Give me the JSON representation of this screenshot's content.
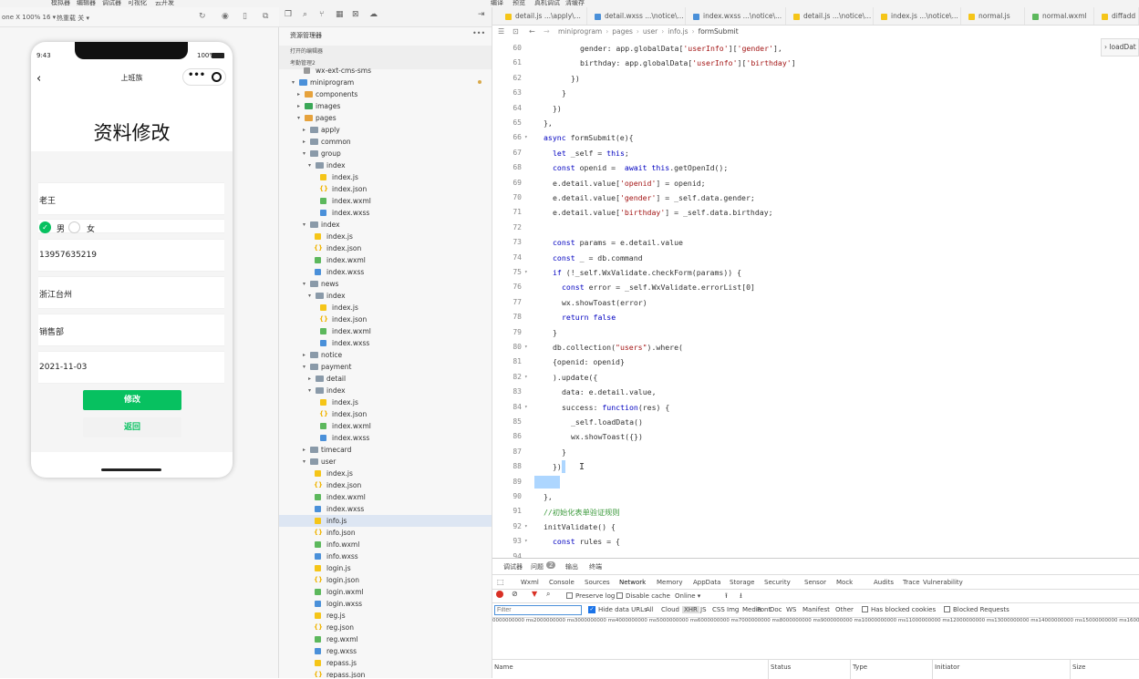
{
  "menu": [
    "模拟器",
    "编辑器",
    "调试器",
    "可视化",
    "云开发",
    "编译",
    "预览",
    "真机调试",
    "清缓存"
  ],
  "simulator": {
    "device": "one X 100% 16 ▾",
    "reload": "热重载 关 ▾",
    "status_time": "9:43",
    "status_battery": "100%",
    "nav_title": "上班族",
    "capsule_dots": "•••",
    "page_title": "资料修改",
    "fields": {
      "name": "老王",
      "gender_male": "男",
      "gender_female": "女",
      "phone": "13957635219",
      "city": "浙江台州",
      "department": "销售部",
      "birthday": "2021-11-03"
    },
    "buttons": {
      "submit": "修改",
      "back": "返回"
    },
    "colors": {
      "primary": "#07c160",
      "back_bg": "#f2f2f2"
    }
  },
  "explorer": {
    "title": "资源管理器",
    "more": "•••",
    "section_open": "打开的编辑器",
    "section_project": "考勤管理2",
    "tree": [
      {
        "d": 2,
        "t": "f",
        "n": "wx-ext-cms-sms",
        "c": "#999"
      },
      {
        "d": 1,
        "t": "o",
        "n": "miniprogram",
        "c": "#4a90d9",
        "dot": true
      },
      {
        "d": 2,
        "t": "c",
        "n": "components",
        "c": "#e6a23c"
      },
      {
        "d": 2,
        "t": "c",
        "n": "images",
        "c": "#3aa757"
      },
      {
        "d": 2,
        "t": "o",
        "n": "pages",
        "c": "#e6a23c"
      },
      {
        "d": 3,
        "t": "c",
        "n": "apply",
        "c": "#8a9aa9"
      },
      {
        "d": 3,
        "t": "c",
        "n": "common",
        "c": "#8a9aa9"
      },
      {
        "d": 3,
        "t": "o",
        "n": "group",
        "c": "#8a9aa9"
      },
      {
        "d": 4,
        "t": "o",
        "n": "index",
        "c": "#8a9aa9"
      },
      {
        "d": 5,
        "t": "f",
        "n": "index.js",
        "c": "#f5c518"
      },
      {
        "d": 5,
        "t": "f",
        "n": "index.json",
        "c": "#f0b400",
        "j": true
      },
      {
        "d": 5,
        "t": "f",
        "n": "index.wxml",
        "c": "#5cb85c"
      },
      {
        "d": 5,
        "t": "f",
        "n": "index.wxss",
        "c": "#4a90d9"
      },
      {
        "d": 3,
        "t": "o",
        "n": "index",
        "c": "#8a9aa9"
      },
      {
        "d": 4,
        "t": "f",
        "n": "index.js",
        "c": "#f5c518"
      },
      {
        "d": 4,
        "t": "f",
        "n": "index.json",
        "c": "#f0b400",
        "j": true
      },
      {
        "d": 4,
        "t": "f",
        "n": "index.wxml",
        "c": "#5cb85c"
      },
      {
        "d": 4,
        "t": "f",
        "n": "index.wxss",
        "c": "#4a90d9"
      },
      {
        "d": 3,
        "t": "o",
        "n": "news",
        "c": "#8a9aa9"
      },
      {
        "d": 4,
        "t": "o",
        "n": "index",
        "c": "#8a9aa9"
      },
      {
        "d": 5,
        "t": "f",
        "n": "index.js",
        "c": "#f5c518"
      },
      {
        "d": 5,
        "t": "f",
        "n": "index.json",
        "c": "#f0b400",
        "j": true
      },
      {
        "d": 5,
        "t": "f",
        "n": "index.wxml",
        "c": "#5cb85c"
      },
      {
        "d": 5,
        "t": "f",
        "n": "index.wxss",
        "c": "#4a90d9"
      },
      {
        "d": 3,
        "t": "c",
        "n": "notice",
        "c": "#8a9aa9"
      },
      {
        "d": 3,
        "t": "o",
        "n": "payment",
        "c": "#8a9aa9"
      },
      {
        "d": 4,
        "t": "c",
        "n": "detail",
        "c": "#8a9aa9"
      },
      {
        "d": 4,
        "t": "o",
        "n": "index",
        "c": "#8a9aa9"
      },
      {
        "d": 5,
        "t": "f",
        "n": "index.js",
        "c": "#f5c518"
      },
      {
        "d": 5,
        "t": "f",
        "n": "index.json",
        "c": "#f0b400",
        "j": true
      },
      {
        "d": 5,
        "t": "f",
        "n": "index.wxml",
        "c": "#5cb85c"
      },
      {
        "d": 5,
        "t": "f",
        "n": "index.wxss",
        "c": "#4a90d9"
      },
      {
        "d": 3,
        "t": "c",
        "n": "timecard",
        "c": "#8a9aa9"
      },
      {
        "d": 3,
        "t": "o",
        "n": "user",
        "c": "#8a9aa9"
      },
      {
        "d": 4,
        "t": "f",
        "n": "index.js",
        "c": "#f5c518"
      },
      {
        "d": 4,
        "t": "f",
        "n": "index.json",
        "c": "#f0b400",
        "j": true
      },
      {
        "d": 4,
        "t": "f",
        "n": "index.wxml",
        "c": "#5cb85c"
      },
      {
        "d": 4,
        "t": "f",
        "n": "index.wxss",
        "c": "#4a90d9"
      },
      {
        "d": 4,
        "t": "f",
        "n": "info.js",
        "c": "#f5c518",
        "sel": true
      },
      {
        "d": 4,
        "t": "f",
        "n": "info.json",
        "c": "#f0b400",
        "j": true
      },
      {
        "d": 4,
        "t": "f",
        "n": "info.wxml",
        "c": "#5cb85c"
      },
      {
        "d": 4,
        "t": "f",
        "n": "info.wxss",
        "c": "#4a90d9"
      },
      {
        "d": 4,
        "t": "f",
        "n": "login.js",
        "c": "#f5c518"
      },
      {
        "d": 4,
        "t": "f",
        "n": "login.json",
        "c": "#f0b400",
        "j": true
      },
      {
        "d": 4,
        "t": "f",
        "n": "login.wxml",
        "c": "#5cb85c"
      },
      {
        "d": 4,
        "t": "f",
        "n": "login.wxss",
        "c": "#4a90d9"
      },
      {
        "d": 4,
        "t": "f",
        "n": "reg.js",
        "c": "#f5c518"
      },
      {
        "d": 4,
        "t": "f",
        "n": "reg.json",
        "c": "#f0b400",
        "j": true
      },
      {
        "d": 4,
        "t": "f",
        "n": "reg.wxml",
        "c": "#5cb85c"
      },
      {
        "d": 4,
        "t": "f",
        "n": "reg.wxss",
        "c": "#4a90d9"
      },
      {
        "d": 4,
        "t": "f",
        "n": "repass.js",
        "c": "#f5c518"
      },
      {
        "d": 4,
        "t": "f",
        "n": "repass.json",
        "c": "#f0b400",
        "j": true
      }
    ]
  },
  "editor": {
    "tabs": [
      {
        "label": "detail.js ...\\apply\\...",
        "c": "#f5c518"
      },
      {
        "label": "detail.wxss ...\\notice\\...",
        "c": "#4a90d9"
      },
      {
        "label": "index.wxss ...\\notice\\...",
        "c": "#4a90d9"
      },
      {
        "label": "detail.js ...\\notice\\...",
        "c": "#f5c518"
      },
      {
        "label": "index.js ...\\notice\\...",
        "c": "#f5c518"
      },
      {
        "label": "normal.js",
        "c": "#f5c518"
      },
      {
        "label": "normal.wxml",
        "c": "#5cb85c"
      },
      {
        "label": "diffadd",
        "c": "#f5c518"
      }
    ],
    "breadcrumb": [
      "miniprogram",
      "pages",
      "user",
      "info.js",
      "formSubmit"
    ],
    "outline_label": "loadDat",
    "lines": [
      {
        "n": "60",
        "i": 4,
        "t": "gender: app.globalData['userInfo']['gender'],"
      },
      {
        "n": "61",
        "i": 4,
        "t": "birthday: app.globalData['userInfo']['birthday']"
      },
      {
        "n": "62",
        "i": 3,
        "t": "})"
      },
      {
        "n": "63",
        "i": 2,
        "t": "}"
      },
      {
        "n": "64",
        "i": 1,
        "t": "})"
      },
      {
        "n": "65",
        "i": 0,
        "t": "},"
      },
      {
        "n": "66",
        "i": 0,
        "t": "async formSubmit(e){",
        "f": true
      },
      {
        "n": "67",
        "i": 1,
        "t": "let _self = this;"
      },
      {
        "n": "68",
        "i": 1,
        "t": "const openid =  await this.getOpenId();"
      },
      {
        "n": "69",
        "i": 1,
        "t": "e.detail.value['openid'] = openid;"
      },
      {
        "n": "70",
        "i": 1,
        "t": "e.detail.value['gender'] = _self.data.gender;"
      },
      {
        "n": "71",
        "i": 1,
        "t": "e.detail.value['birthday'] = _self.data.birthday;"
      },
      {
        "n": "72",
        "i": 0,
        "t": ""
      },
      {
        "n": "73",
        "i": 1,
        "t": "const params = e.detail.value"
      },
      {
        "n": "74",
        "i": 1,
        "t": "const _ = db.command"
      },
      {
        "n": "75",
        "i": 1,
        "t": "if (!_self.WxValidate.checkForm(params)) {",
        "f": true
      },
      {
        "n": "76",
        "i": 2,
        "t": "const error = _self.WxValidate.errorList[0]"
      },
      {
        "n": "77",
        "i": 2,
        "t": "wx.showToast(error)"
      },
      {
        "n": "78",
        "i": 2,
        "t": "return false"
      },
      {
        "n": "79",
        "i": 1,
        "t": "}"
      },
      {
        "n": "80",
        "i": 1,
        "t": "db.collection(\"users\").where(",
        "f": true
      },
      {
        "n": "81",
        "i": 1,
        "t": "{openid: openid}"
      },
      {
        "n": "82",
        "i": 1,
        "t": ").update({",
        "f": true
      },
      {
        "n": "83",
        "i": 2,
        "t": "data: e.detail.value,"
      },
      {
        "n": "84",
        "i": 2,
        "t": "success: function(res) {",
        "f": true
      },
      {
        "n": "85",
        "i": 3,
        "t": "_self.loadData()"
      },
      {
        "n": "86",
        "i": 3,
        "t": "wx.showToast({})"
      },
      {
        "n": "87",
        "i": 2,
        "t": "}"
      },
      {
        "n": "88",
        "i": 1,
        "t": "})"
      },
      {
        "n": "89",
        "i": 0,
        "t": ""
      },
      {
        "n": "90",
        "i": 0,
        "t": "},"
      },
      {
        "n": "91",
        "i": 0,
        "t": "//初始化表单验证规则"
      },
      {
        "n": "92",
        "i": 0,
        "t": "initValidate() {",
        "f": true
      },
      {
        "n": "93",
        "i": 1,
        "t": "const rules = {",
        "f": true
      },
      {
        "n": "94",
        "i": 2,
        "t": ""
      }
    ]
  },
  "devtools": {
    "top_tabs": [
      "调试器",
      "问题",
      "输出",
      "终端"
    ],
    "problem_count": "2",
    "panels": [
      "Wxml",
      "Console",
      "Sources",
      "Network",
      "Memory",
      "AppData",
      "Storage",
      "Security",
      "Sensor",
      "Mock",
      "Audits",
      "Trace",
      "Vulnerability"
    ],
    "active_panel": "Network",
    "preserve_log": "Preserve log",
    "disable_cache": "Disable cache",
    "throttle": "Online",
    "filter_placeholder": "Filter",
    "hide_data_urls": "Hide data URLs",
    "types": [
      "All",
      "Cloud",
      "XHR",
      "JS",
      "CSS",
      "Img",
      "Media",
      "Font",
      "Doc",
      "WS",
      "Manifest",
      "Other"
    ],
    "has_blocked_cookies": "Has blocked cookies",
    "blocked_requests": "Blocked Requests",
    "timeline": "0000000000 ms2000000000 ms3000000000 ms4000000000 ms5000000000 ms6000000000 ms7000000000 ms8000000000 ms9000000000 ms10000000000 ms11000000000 ms12000000000 ms13000000000 ms14000000000 ms15000000000 ms16000000",
    "columns": [
      "Name",
      "Status",
      "Type",
      "Initiator",
      "Size"
    ]
  }
}
